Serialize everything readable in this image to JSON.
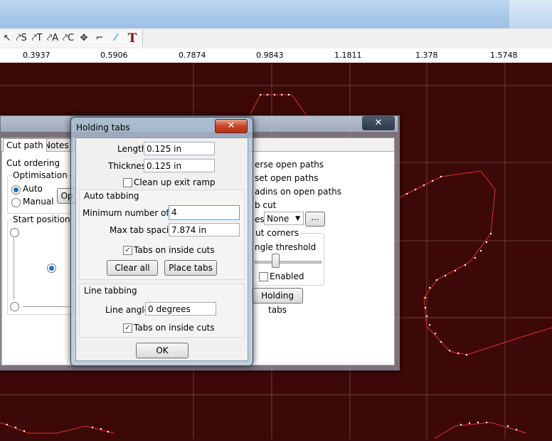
{
  "toolbar": {
    "icons": [
      "select-arrow-icon",
      "select-shape-icon",
      "node-text-icon",
      "node-arrow-icon",
      "node-edit-icon",
      "move-icon",
      "crop-icon",
      "wand-icon",
      "text-tool-icon"
    ],
    "glyphs": [
      "↖",
      "⤤S",
      "⤤T",
      "⤤A",
      "⤤C",
      "✥",
      "⌐",
      "⁄",
      "T"
    ]
  },
  "ruler": {
    "ticks": [
      "0.3937",
      "0.5906",
      "0.7874",
      "0.9843",
      "1.1811",
      "1.378",
      "1.5748"
    ]
  },
  "back_window": {
    "close_label": "✕",
    "tabs": {
      "cut_path": "Cut path",
      "notes": "Notes"
    },
    "cut_ordering": "Cut ordering",
    "optimisation": "Optimisation",
    "auto": "Auto",
    "manual": "Manual",
    "op_button": "Op",
    "start_position": "Start position",
    "right": {
      "reverse_open_paths": "erse open paths",
      "set_open_paths": "set open paths",
      "leadins_on_open_paths": "adins on open paths",
      "tab_cut": "b cut",
      "tabs_label": "es",
      "tabs_select": "None",
      "ellipsis": "...",
      "cut_corners": "ut corners",
      "angle_threshold": "ngle threshold",
      "enabled": "Enabled",
      "holding_tabs_button": "Holding tabs"
    }
  },
  "dialog": {
    "title": "Holding tabs",
    "close_label": "✕",
    "length_label": "Length",
    "length_value": "0.125 in",
    "thickness_label": "Thickness",
    "thickness_value": "0.125 in",
    "clean_up_label": "Clean up exit ramp",
    "auto_tabbing": "Auto tabbing",
    "min_tabs_label": "Minimum number of tabs",
    "min_tabs_value": "4",
    "max_spacing_label": "Max tab spacing",
    "max_spacing_value": "7.874 in",
    "tabs_inside_auto": "Tabs on inside cuts",
    "clear_all": "Clear all",
    "place_tabs": "Place tabs",
    "line_tabbing": "Line tabbing",
    "line_angle_label": "Line angle",
    "line_angle_value": "0 degrees",
    "tabs_inside_line": "Tabs on inside cuts",
    "ok": "OK"
  }
}
